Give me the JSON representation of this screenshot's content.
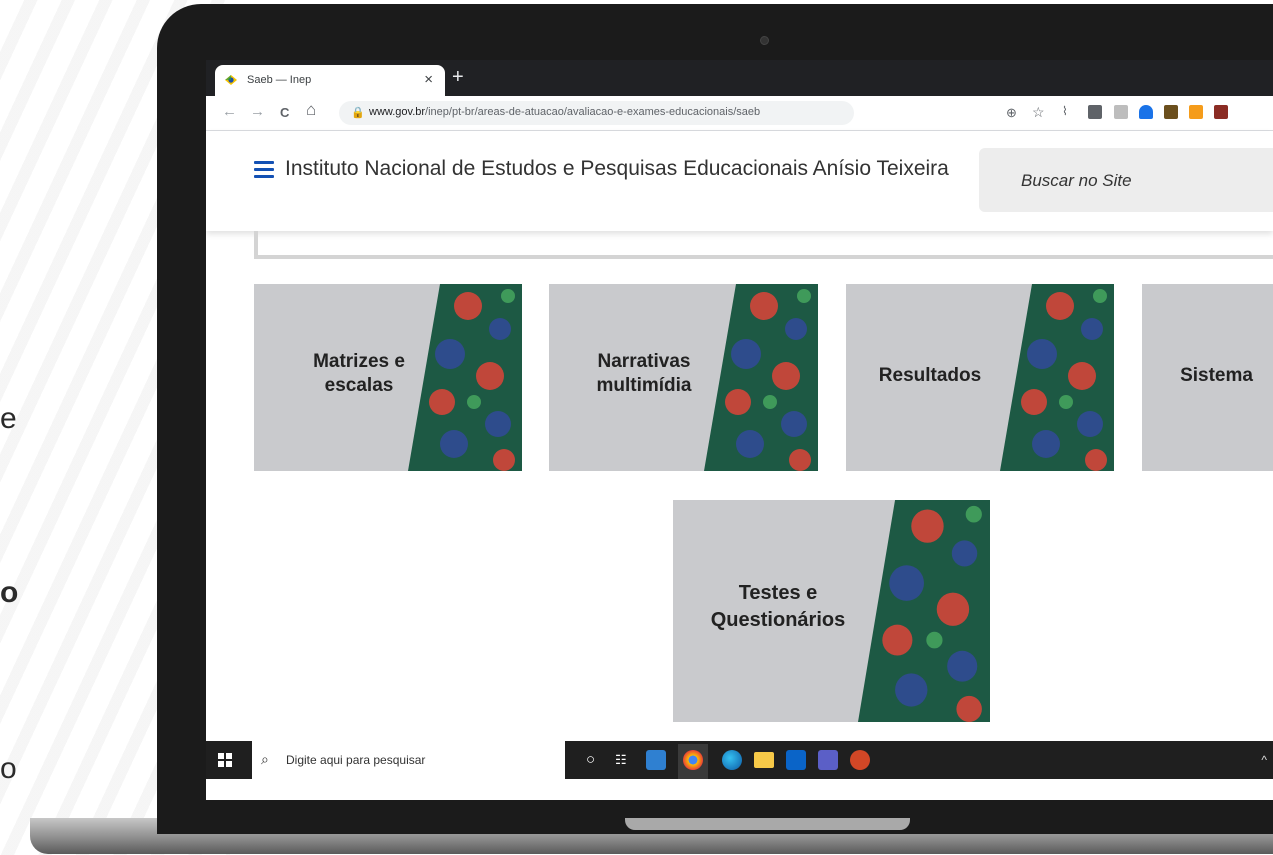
{
  "side_fragments": [
    "e",
    "o",
    "o"
  ],
  "browser": {
    "tab": {
      "title": "Saeb — Inep",
      "close": "×"
    },
    "new_tab": "+",
    "nav": {
      "back": "←",
      "forward": "→",
      "reload": "C",
      "home": "⌂"
    },
    "url_domain": "www.gov.br",
    "url_path": "/inep/pt-br/areas-de-atuacao/avaliacao-e-exames-educacionais/saeb",
    "zoom_icon": "⊕",
    "star_icon": "☆"
  },
  "site": {
    "title": "Instituto Nacional de Estudos e Pesquisas Educacionais Anísio Teixeira",
    "search_placeholder": "Buscar no Site"
  },
  "cards": [
    {
      "label_lines": [
        "Matrizes e",
        "escalas"
      ]
    },
    {
      "label_lines": [
        "Narrativas",
        "multimídia"
      ]
    },
    {
      "label_lines": [
        "Resultados"
      ]
    },
    {
      "label_lines": [
        "Sistema"
      ]
    },
    {
      "label_lines": [
        "Testes e",
        "Questionários"
      ]
    }
  ],
  "taskbar": {
    "search_placeholder": "Digite aqui para pesquisar",
    "tray": "^"
  },
  "colors": {
    "brand_blue": "#1351b4",
    "card_bg": "#c9cacd",
    "pattern_green": "#1d5944",
    "pattern_red": "#c0473a",
    "pattern_blue": "#2e4c8c"
  }
}
